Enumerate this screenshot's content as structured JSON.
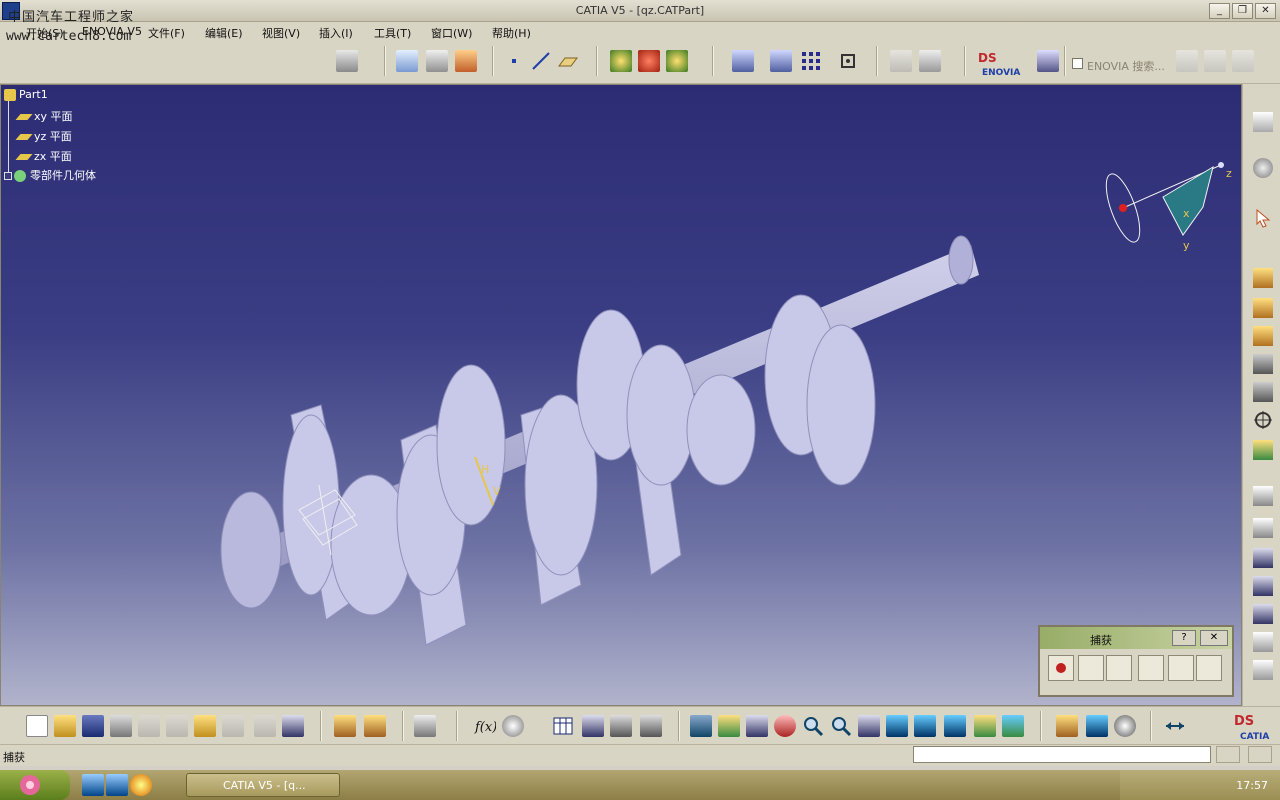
{
  "window": {
    "title": "CATIA V5 - [qz.CATPart]",
    "watermark_top": "中国汽车工程师之家",
    "watermark_url": "www.cartech8.com",
    "controls": [
      "_",
      "❐",
      "✕"
    ]
  },
  "menu": {
    "items": [
      "开始(S)",
      "ENOVIA V5",
      "文件(F)",
      "编辑(E)",
      "视图(V)",
      "插入(I)",
      "工具(T)",
      "窗口(W)",
      "帮助(H)"
    ]
  },
  "toolbar_top": {
    "enovia_brand": "ENOVIA",
    "enovia_search_label": "ENOVIA 搜索..."
  },
  "tree": {
    "root": "Part1",
    "items": [
      "xy 平面",
      "yz 平面",
      "zx 平面",
      "零部件几何体"
    ]
  },
  "compass": {
    "axis_x": "x",
    "axis_y": "y",
    "axis_z": "z"
  },
  "model": {
    "marker_h": "H",
    "marker_v": "V"
  },
  "capture_panel": {
    "title": "捕获",
    "help": "?",
    "close": "✕"
  },
  "status": {
    "text": "捕获"
  },
  "bottom_toolbar": {
    "brand": "CATIA"
  },
  "taskbar": {
    "task_label": "CATIA V5 - [q...",
    "clock": "17:57"
  },
  "colors": {
    "viewport_top": "#2c2c74",
    "viewport_bottom": "#b1b3cc",
    "model": "#c7c7e6",
    "model_shade": "#9d9dc6"
  }
}
